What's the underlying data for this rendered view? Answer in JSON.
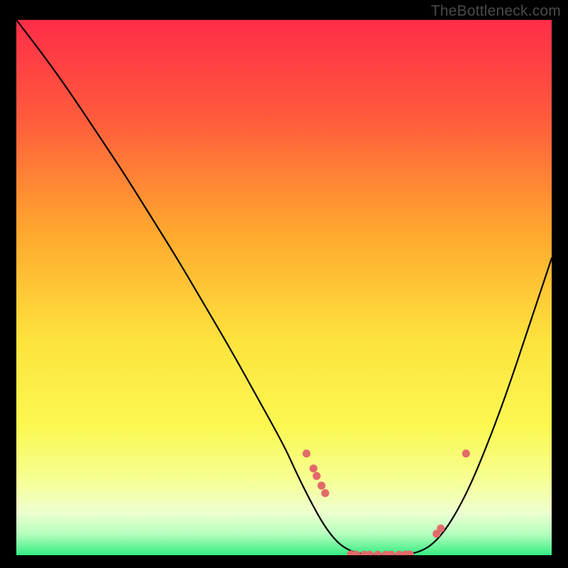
{
  "watermark": "TheBottleneck.com",
  "chart_data": {
    "type": "line",
    "title": "",
    "xlabel": "",
    "ylabel": "",
    "xlim": [
      0,
      100
    ],
    "ylim": [
      0,
      100
    ],
    "grid": false,
    "legend": false,
    "background_gradient": {
      "top": "#ff2d48",
      "mid1": "#ffb72e",
      "mid2": "#fbf851",
      "low": "#f3ffc7",
      "bottom": "#34ec81"
    },
    "curve": [
      {
        "x": 0.0,
        "y": 100.0
      },
      {
        "x": 5.0,
        "y": 93.5
      },
      {
        "x": 10.0,
        "y": 86.5
      },
      {
        "x": 15.0,
        "y": 79.0
      },
      {
        "x": 20.0,
        "y": 71.5
      },
      {
        "x": 25.0,
        "y": 63.5
      },
      {
        "x": 30.0,
        "y": 55.5
      },
      {
        "x": 35.0,
        "y": 47.0
      },
      {
        "x": 40.0,
        "y": 38.5
      },
      {
        "x": 45.0,
        "y": 29.5
      },
      {
        "x": 50.0,
        "y": 20.5
      },
      {
        "x": 52.5,
        "y": 15.0
      },
      {
        "x": 55.0,
        "y": 10.0
      },
      {
        "x": 57.5,
        "y": 5.5
      },
      {
        "x": 60.0,
        "y": 2.3
      },
      {
        "x": 62.5,
        "y": 0.7
      },
      {
        "x": 65.0,
        "y": 0.15
      },
      {
        "x": 67.5,
        "y": 0.1
      },
      {
        "x": 70.0,
        "y": 0.1
      },
      {
        "x": 72.5,
        "y": 0.15
      },
      {
        "x": 75.0,
        "y": 0.5
      },
      {
        "x": 77.5,
        "y": 1.8
      },
      {
        "x": 80.0,
        "y": 4.5
      },
      {
        "x": 82.5,
        "y": 8.5
      },
      {
        "x": 85.0,
        "y": 13.5
      },
      {
        "x": 87.5,
        "y": 19.5
      },
      {
        "x": 90.0,
        "y": 26.0
      },
      {
        "x": 92.5,
        "y": 33.0
      },
      {
        "x": 95.0,
        "y": 40.5
      },
      {
        "x": 97.5,
        "y": 48.0
      },
      {
        "x": 100.0,
        "y": 55.5
      }
    ],
    "markers": [
      {
        "x": 54.2,
        "y": 19.0
      },
      {
        "x": 55.5,
        "y": 16.2
      },
      {
        "x": 56.1,
        "y": 14.8
      },
      {
        "x": 57.0,
        "y": 13.0
      },
      {
        "x": 57.7,
        "y": 11.6
      },
      {
        "x": 62.5,
        "y": 0.15
      },
      {
        "x": 63.5,
        "y": 0.1
      },
      {
        "x": 65.0,
        "y": 0.1
      },
      {
        "x": 66.0,
        "y": 0.1
      },
      {
        "x": 67.5,
        "y": 0.1
      },
      {
        "x": 69.0,
        "y": 0.1
      },
      {
        "x": 70.0,
        "y": 0.1
      },
      {
        "x": 71.5,
        "y": 0.1
      },
      {
        "x": 72.7,
        "y": 0.12
      },
      {
        "x": 73.5,
        "y": 0.15
      },
      {
        "x": 78.5,
        "y": 4.0
      },
      {
        "x": 79.3,
        "y": 5.0
      },
      {
        "x": 84.0,
        "y": 19.0
      }
    ],
    "marker_color": "#e26a6a"
  }
}
